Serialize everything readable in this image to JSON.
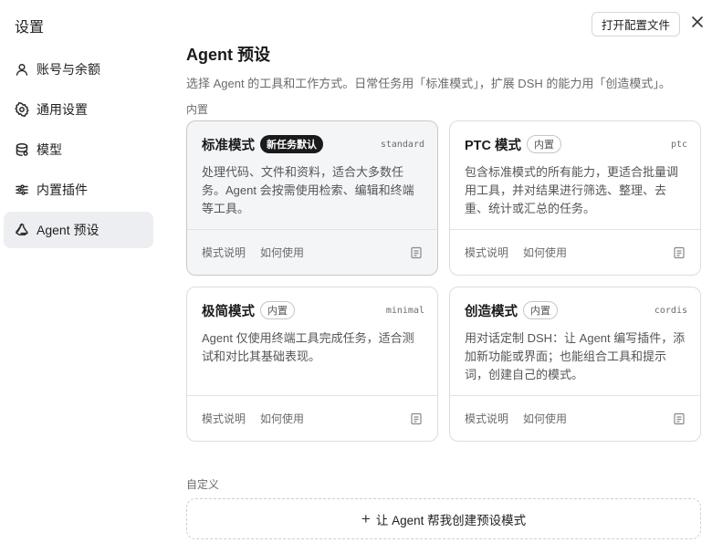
{
  "settings_title": "设置",
  "sidebar": {
    "items": [
      {
        "label": "账号与余额",
        "icon": "user-icon",
        "active": false
      },
      {
        "label": "通用设置",
        "icon": "gear-icon",
        "active": false
      },
      {
        "label": "模型",
        "icon": "database-icon",
        "active": false
      },
      {
        "label": "内置插件",
        "icon": "sliders-icon",
        "active": false
      },
      {
        "label": "Agent 预设",
        "icon": "recycle-icon",
        "active": true
      }
    ]
  },
  "header": {
    "open_config_label": "打开配置文件",
    "close_icon": "close-icon"
  },
  "main": {
    "title": "Agent 预设",
    "description": "选择 Agent 的工具和工作方式。日常任务用「标准模式」，扩展 DSH 的能力用「创造模式」。",
    "builtin_label": "内置",
    "cards": [
      {
        "name": "标准模式",
        "badge": "新任务默认",
        "code": "standard",
        "description": "处理代码、文件和资料，适合大多数任务。Agent 会按需使用检索、编辑和终端等工具。",
        "link1": "模式说明",
        "link2": "如何使用"
      },
      {
        "name": "PTC 模式",
        "badge": "内置",
        "code": "ptc",
        "description": "包含标准模式的所有能力，更适合批量调用工具，并对结果进行筛选、整理、去重、统计或汇总的任务。",
        "link1": "模式说明",
        "link2": "如何使用"
      },
      {
        "name": "极简模式",
        "badge": "内置",
        "code": "minimal",
        "description": "Agent 仅使用终端工具完成任务，适合测试和对比其基础表现。",
        "link1": "模式说明",
        "link2": "如何使用"
      },
      {
        "name": "创造模式",
        "badge": "内置",
        "code": "cordis",
        "description": "用对话定制 DSH：让 Agent 编写插件，添加新功能或界面；也能组合工具和提示词，创建自己的模式。",
        "link1": "模式说明",
        "link2": "如何使用"
      }
    ],
    "custom_label": "自定义",
    "create_label": "让 Agent 帮我创建预设模式"
  }
}
